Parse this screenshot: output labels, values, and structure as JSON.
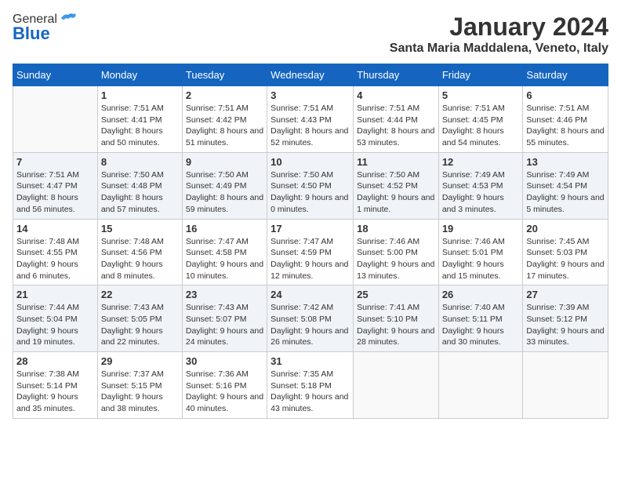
{
  "header": {
    "logo_general": "General",
    "logo_blue": "Blue",
    "month_title": "January 2024",
    "location": "Santa Maria Maddalena, Veneto, Italy"
  },
  "weekdays": [
    "Sunday",
    "Monday",
    "Tuesday",
    "Wednesday",
    "Thursday",
    "Friday",
    "Saturday"
  ],
  "weeks": [
    [
      {
        "day": "",
        "sunrise": "",
        "sunset": "",
        "daylight": ""
      },
      {
        "day": "1",
        "sunrise": "Sunrise: 7:51 AM",
        "sunset": "Sunset: 4:41 PM",
        "daylight": "Daylight: 8 hours and 50 minutes."
      },
      {
        "day": "2",
        "sunrise": "Sunrise: 7:51 AM",
        "sunset": "Sunset: 4:42 PM",
        "daylight": "Daylight: 8 hours and 51 minutes."
      },
      {
        "day": "3",
        "sunrise": "Sunrise: 7:51 AM",
        "sunset": "Sunset: 4:43 PM",
        "daylight": "Daylight: 8 hours and 52 minutes."
      },
      {
        "day": "4",
        "sunrise": "Sunrise: 7:51 AM",
        "sunset": "Sunset: 4:44 PM",
        "daylight": "Daylight: 8 hours and 53 minutes."
      },
      {
        "day": "5",
        "sunrise": "Sunrise: 7:51 AM",
        "sunset": "Sunset: 4:45 PM",
        "daylight": "Daylight: 8 hours and 54 minutes."
      },
      {
        "day": "6",
        "sunrise": "Sunrise: 7:51 AM",
        "sunset": "Sunset: 4:46 PM",
        "daylight": "Daylight: 8 hours and 55 minutes."
      }
    ],
    [
      {
        "day": "7",
        "sunrise": "Sunrise: 7:51 AM",
        "sunset": "Sunset: 4:47 PM",
        "daylight": "Daylight: 8 hours and 56 minutes."
      },
      {
        "day": "8",
        "sunrise": "Sunrise: 7:50 AM",
        "sunset": "Sunset: 4:48 PM",
        "daylight": "Daylight: 8 hours and 57 minutes."
      },
      {
        "day": "9",
        "sunrise": "Sunrise: 7:50 AM",
        "sunset": "Sunset: 4:49 PM",
        "daylight": "Daylight: 8 hours and 59 minutes."
      },
      {
        "day": "10",
        "sunrise": "Sunrise: 7:50 AM",
        "sunset": "Sunset: 4:50 PM",
        "daylight": "Daylight: 9 hours and 0 minutes."
      },
      {
        "day": "11",
        "sunrise": "Sunrise: 7:50 AM",
        "sunset": "Sunset: 4:52 PM",
        "daylight": "Daylight: 9 hours and 1 minute."
      },
      {
        "day": "12",
        "sunrise": "Sunrise: 7:49 AM",
        "sunset": "Sunset: 4:53 PM",
        "daylight": "Daylight: 9 hours and 3 minutes."
      },
      {
        "day": "13",
        "sunrise": "Sunrise: 7:49 AM",
        "sunset": "Sunset: 4:54 PM",
        "daylight": "Daylight: 9 hours and 5 minutes."
      }
    ],
    [
      {
        "day": "14",
        "sunrise": "Sunrise: 7:48 AM",
        "sunset": "Sunset: 4:55 PM",
        "daylight": "Daylight: 9 hours and 6 minutes."
      },
      {
        "day": "15",
        "sunrise": "Sunrise: 7:48 AM",
        "sunset": "Sunset: 4:56 PM",
        "daylight": "Daylight: 9 hours and 8 minutes."
      },
      {
        "day": "16",
        "sunrise": "Sunrise: 7:47 AM",
        "sunset": "Sunset: 4:58 PM",
        "daylight": "Daylight: 9 hours and 10 minutes."
      },
      {
        "day": "17",
        "sunrise": "Sunrise: 7:47 AM",
        "sunset": "Sunset: 4:59 PM",
        "daylight": "Daylight: 9 hours and 12 minutes."
      },
      {
        "day": "18",
        "sunrise": "Sunrise: 7:46 AM",
        "sunset": "Sunset: 5:00 PM",
        "daylight": "Daylight: 9 hours and 13 minutes."
      },
      {
        "day": "19",
        "sunrise": "Sunrise: 7:46 AM",
        "sunset": "Sunset: 5:01 PM",
        "daylight": "Daylight: 9 hours and 15 minutes."
      },
      {
        "day": "20",
        "sunrise": "Sunrise: 7:45 AM",
        "sunset": "Sunset: 5:03 PM",
        "daylight": "Daylight: 9 hours and 17 minutes."
      }
    ],
    [
      {
        "day": "21",
        "sunrise": "Sunrise: 7:44 AM",
        "sunset": "Sunset: 5:04 PM",
        "daylight": "Daylight: 9 hours and 19 minutes."
      },
      {
        "day": "22",
        "sunrise": "Sunrise: 7:43 AM",
        "sunset": "Sunset: 5:05 PM",
        "daylight": "Daylight: 9 hours and 22 minutes."
      },
      {
        "day": "23",
        "sunrise": "Sunrise: 7:43 AM",
        "sunset": "Sunset: 5:07 PM",
        "daylight": "Daylight: 9 hours and 24 minutes."
      },
      {
        "day": "24",
        "sunrise": "Sunrise: 7:42 AM",
        "sunset": "Sunset: 5:08 PM",
        "daylight": "Daylight: 9 hours and 26 minutes."
      },
      {
        "day": "25",
        "sunrise": "Sunrise: 7:41 AM",
        "sunset": "Sunset: 5:10 PM",
        "daylight": "Daylight: 9 hours and 28 minutes."
      },
      {
        "day": "26",
        "sunrise": "Sunrise: 7:40 AM",
        "sunset": "Sunset: 5:11 PM",
        "daylight": "Daylight: 9 hours and 30 minutes."
      },
      {
        "day": "27",
        "sunrise": "Sunrise: 7:39 AM",
        "sunset": "Sunset: 5:12 PM",
        "daylight": "Daylight: 9 hours and 33 minutes."
      }
    ],
    [
      {
        "day": "28",
        "sunrise": "Sunrise: 7:38 AM",
        "sunset": "Sunset: 5:14 PM",
        "daylight": "Daylight: 9 hours and 35 minutes."
      },
      {
        "day": "29",
        "sunrise": "Sunrise: 7:37 AM",
        "sunset": "Sunset: 5:15 PM",
        "daylight": "Daylight: 9 hours and 38 minutes."
      },
      {
        "day": "30",
        "sunrise": "Sunrise: 7:36 AM",
        "sunset": "Sunset: 5:16 PM",
        "daylight": "Daylight: 9 hours and 40 minutes."
      },
      {
        "day": "31",
        "sunrise": "Sunrise: 7:35 AM",
        "sunset": "Sunset: 5:18 PM",
        "daylight": "Daylight: 9 hours and 43 minutes."
      },
      {
        "day": "",
        "sunrise": "",
        "sunset": "",
        "daylight": ""
      },
      {
        "day": "",
        "sunrise": "",
        "sunset": "",
        "daylight": ""
      },
      {
        "day": "",
        "sunrise": "",
        "sunset": "",
        "daylight": ""
      }
    ]
  ]
}
